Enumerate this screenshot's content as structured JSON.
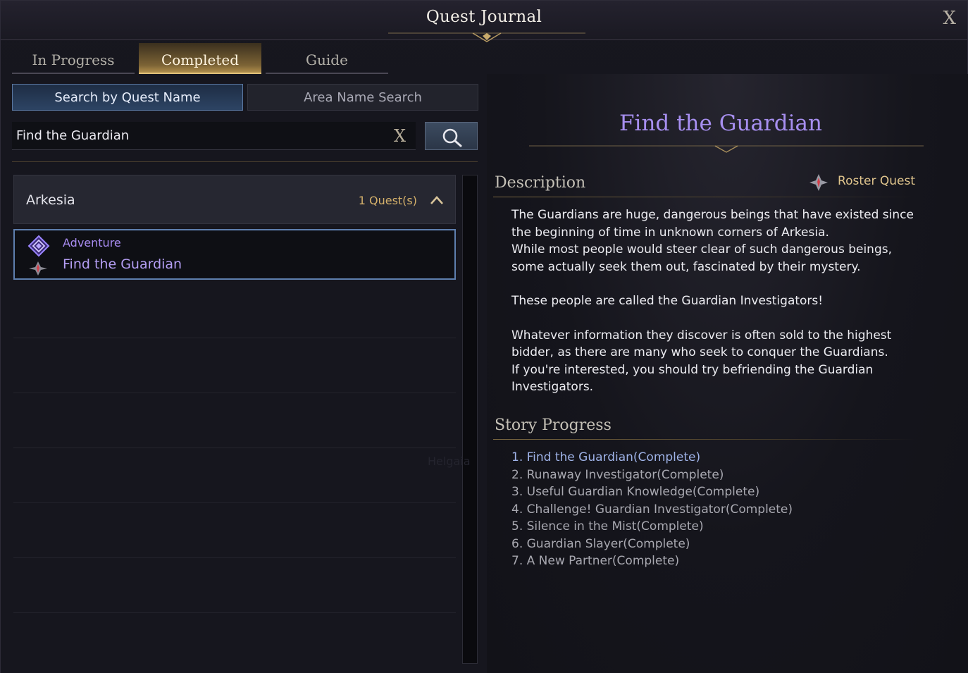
{
  "window": {
    "title": "Quest Journal",
    "close_label": "X"
  },
  "tabs": [
    {
      "label": "In Progress",
      "active": false
    },
    {
      "label": "Completed",
      "active": true
    },
    {
      "label": "Guide",
      "active": false
    }
  ],
  "search": {
    "modes": [
      {
        "label": "Search by Quest Name",
        "active": true
      },
      {
        "label": "Area Name Search",
        "active": false
      }
    ],
    "value": "Find the Guardian",
    "clear_label": "X",
    "button_icon": "search-icon"
  },
  "list": {
    "group": {
      "name": "Arkesia",
      "count": "1 Quest(s)",
      "expanded": true
    },
    "items": [
      {
        "category": "Adventure",
        "name": "Find the Guardian",
        "category_icon": "adventure-icon",
        "type_icon": "roster-quest-icon"
      }
    ],
    "faded_label": "Helgaia"
  },
  "detail": {
    "title": "Find the Guardian",
    "description_heading": "Description",
    "quest_type": "Roster Quest",
    "description": [
      "The Guardians are huge, dangerous beings that have existed since the beginning of time in unknown corners of Arkesia.",
      "While most people would steer clear of such dangerous beings, some actually seek them out, fascinated by their mystery.",
      "",
      "These people are called the Guardian Investigators!",
      "",
      "Whatever information they discover is often sold to the highest bidder, as there are many who seek to conquer the Guardians.",
      "If you're interested, you should try befriending the Guardian Investigators."
    ],
    "story_heading": "Story Progress",
    "story": [
      "1. Find the Guardian(Complete)",
      "2. Runaway Investigator(Complete)",
      "3. Useful Guardian Knowledge(Complete)",
      "4. Challenge! Guardian Investigator(Complete)",
      "5. Silence in the Mist(Complete)",
      "6. Guardian Slayer(Complete)",
      "7. A New Partner(Complete)"
    ],
    "colors": {
      "title": "#a78ff0",
      "current_step": "#9fb3e8",
      "roster": "#dfc48c"
    }
  }
}
